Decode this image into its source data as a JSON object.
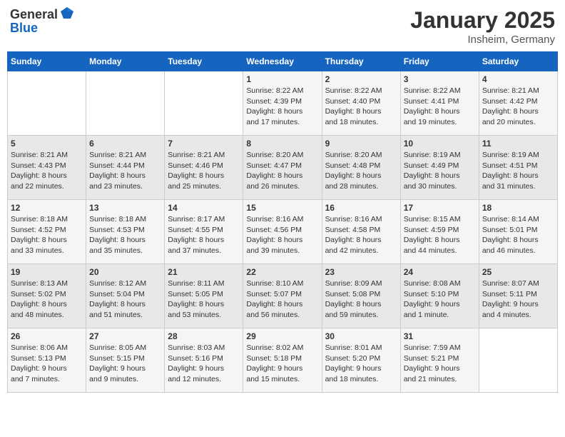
{
  "header": {
    "logo_general": "General",
    "logo_blue": "Blue",
    "title": "January 2025",
    "subtitle": "Insheim, Germany"
  },
  "weekdays": [
    "Sunday",
    "Monday",
    "Tuesday",
    "Wednesday",
    "Thursday",
    "Friday",
    "Saturday"
  ],
  "weeks": [
    [
      {
        "day": "",
        "info": ""
      },
      {
        "day": "",
        "info": ""
      },
      {
        "day": "",
        "info": ""
      },
      {
        "day": "1",
        "info": "Sunrise: 8:22 AM\nSunset: 4:39 PM\nDaylight: 8 hours\nand 17 minutes."
      },
      {
        "day": "2",
        "info": "Sunrise: 8:22 AM\nSunset: 4:40 PM\nDaylight: 8 hours\nand 18 minutes."
      },
      {
        "day": "3",
        "info": "Sunrise: 8:22 AM\nSunset: 4:41 PM\nDaylight: 8 hours\nand 19 minutes."
      },
      {
        "day": "4",
        "info": "Sunrise: 8:21 AM\nSunset: 4:42 PM\nDaylight: 8 hours\nand 20 minutes."
      }
    ],
    [
      {
        "day": "5",
        "info": "Sunrise: 8:21 AM\nSunset: 4:43 PM\nDaylight: 8 hours\nand 22 minutes."
      },
      {
        "day": "6",
        "info": "Sunrise: 8:21 AM\nSunset: 4:44 PM\nDaylight: 8 hours\nand 23 minutes."
      },
      {
        "day": "7",
        "info": "Sunrise: 8:21 AM\nSunset: 4:46 PM\nDaylight: 8 hours\nand 25 minutes."
      },
      {
        "day": "8",
        "info": "Sunrise: 8:20 AM\nSunset: 4:47 PM\nDaylight: 8 hours\nand 26 minutes."
      },
      {
        "day": "9",
        "info": "Sunrise: 8:20 AM\nSunset: 4:48 PM\nDaylight: 8 hours\nand 28 minutes."
      },
      {
        "day": "10",
        "info": "Sunrise: 8:19 AM\nSunset: 4:49 PM\nDaylight: 8 hours\nand 30 minutes."
      },
      {
        "day": "11",
        "info": "Sunrise: 8:19 AM\nSunset: 4:51 PM\nDaylight: 8 hours\nand 31 minutes."
      }
    ],
    [
      {
        "day": "12",
        "info": "Sunrise: 8:18 AM\nSunset: 4:52 PM\nDaylight: 8 hours\nand 33 minutes."
      },
      {
        "day": "13",
        "info": "Sunrise: 8:18 AM\nSunset: 4:53 PM\nDaylight: 8 hours\nand 35 minutes."
      },
      {
        "day": "14",
        "info": "Sunrise: 8:17 AM\nSunset: 4:55 PM\nDaylight: 8 hours\nand 37 minutes."
      },
      {
        "day": "15",
        "info": "Sunrise: 8:16 AM\nSunset: 4:56 PM\nDaylight: 8 hours\nand 39 minutes."
      },
      {
        "day": "16",
        "info": "Sunrise: 8:16 AM\nSunset: 4:58 PM\nDaylight: 8 hours\nand 42 minutes."
      },
      {
        "day": "17",
        "info": "Sunrise: 8:15 AM\nSunset: 4:59 PM\nDaylight: 8 hours\nand 44 minutes."
      },
      {
        "day": "18",
        "info": "Sunrise: 8:14 AM\nSunset: 5:01 PM\nDaylight: 8 hours\nand 46 minutes."
      }
    ],
    [
      {
        "day": "19",
        "info": "Sunrise: 8:13 AM\nSunset: 5:02 PM\nDaylight: 8 hours\nand 48 minutes."
      },
      {
        "day": "20",
        "info": "Sunrise: 8:12 AM\nSunset: 5:04 PM\nDaylight: 8 hours\nand 51 minutes."
      },
      {
        "day": "21",
        "info": "Sunrise: 8:11 AM\nSunset: 5:05 PM\nDaylight: 8 hours\nand 53 minutes."
      },
      {
        "day": "22",
        "info": "Sunrise: 8:10 AM\nSunset: 5:07 PM\nDaylight: 8 hours\nand 56 minutes."
      },
      {
        "day": "23",
        "info": "Sunrise: 8:09 AM\nSunset: 5:08 PM\nDaylight: 8 hours\nand 59 minutes."
      },
      {
        "day": "24",
        "info": "Sunrise: 8:08 AM\nSunset: 5:10 PM\nDaylight: 9 hours\nand 1 minute."
      },
      {
        "day": "25",
        "info": "Sunrise: 8:07 AM\nSunset: 5:11 PM\nDaylight: 9 hours\nand 4 minutes."
      }
    ],
    [
      {
        "day": "26",
        "info": "Sunrise: 8:06 AM\nSunset: 5:13 PM\nDaylight: 9 hours\nand 7 minutes."
      },
      {
        "day": "27",
        "info": "Sunrise: 8:05 AM\nSunset: 5:15 PM\nDaylight: 9 hours\nand 9 minutes."
      },
      {
        "day": "28",
        "info": "Sunrise: 8:03 AM\nSunset: 5:16 PM\nDaylight: 9 hours\nand 12 minutes."
      },
      {
        "day": "29",
        "info": "Sunrise: 8:02 AM\nSunset: 5:18 PM\nDaylight: 9 hours\nand 15 minutes."
      },
      {
        "day": "30",
        "info": "Sunrise: 8:01 AM\nSunset: 5:20 PM\nDaylight: 9 hours\nand 18 minutes."
      },
      {
        "day": "31",
        "info": "Sunrise: 7:59 AM\nSunset: 5:21 PM\nDaylight: 9 hours\nand 21 minutes."
      },
      {
        "day": "",
        "info": ""
      }
    ]
  ]
}
